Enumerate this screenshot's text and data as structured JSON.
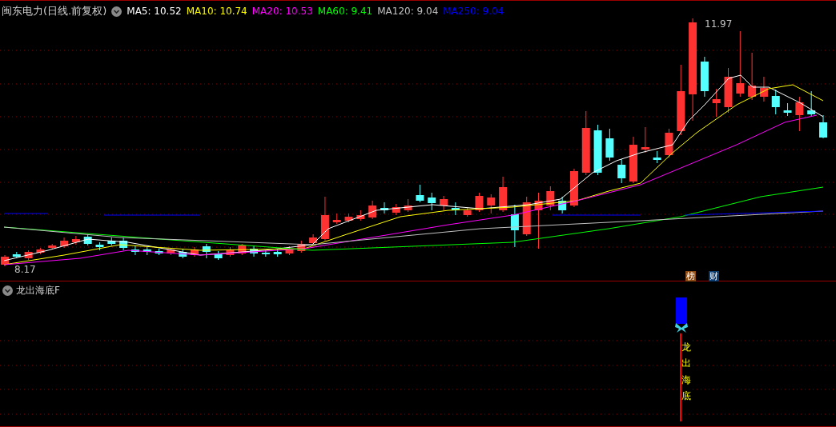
{
  "header": {
    "title": "闽东电力(日线.前复权)",
    "indicators": [
      {
        "label": "MA5: 10.52",
        "color": "#ffffff"
      },
      {
        "label": "MA10: 10.74",
        "color": "#ffff00"
      },
      {
        "label": "MA20: 10.53",
        "color": "#ff00ff"
      },
      {
        "label": "MA60: 9.41",
        "color": "#00ff00"
      },
      {
        "label": "MA120: 9.04",
        "color": "#c0c0c0"
      },
      {
        "label": "MA250: 9.04",
        "color": "#0000ff"
      }
    ]
  },
  "price_chart": {
    "high_label": "11.97",
    "low_label": "8.17",
    "badges": [
      {
        "text": "榜",
        "color": "#8b4a14"
      },
      {
        "text": "财",
        "color": "#0b3a6e"
      }
    ]
  },
  "indicator_panel": {
    "title": "龙出海底F",
    "signal_text": "龙出海底"
  }
}
